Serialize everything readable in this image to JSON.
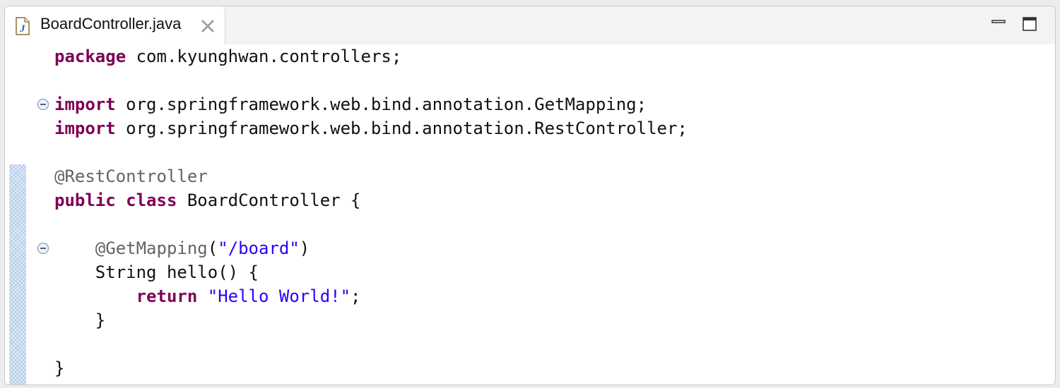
{
  "editor": {
    "tab": {
      "icon": "java-file-icon",
      "title": "BoardController.java",
      "close_icon": "close-x-icon"
    },
    "window_controls": {
      "minimize_icon": "minimize-icon",
      "maximize_icon": "maximize-icon"
    },
    "colors": {
      "keyword": "#7f0055",
      "annotation": "#646464",
      "string": "#2a00ff",
      "text": "#111111",
      "change_ruler": "#dde8f6"
    },
    "code": {
      "line1": {
        "kw": "package",
        "rest": " com.kyunghwan.controllers;"
      },
      "line3": {
        "kw": "import",
        "rest": " org.springframework.web.bind.annotation.GetMapping;"
      },
      "line4": {
        "kw": "import",
        "rest": " org.springframework.web.bind.annotation.RestController;"
      },
      "line6": {
        "ann": "@RestController"
      },
      "line7": {
        "kw1": "public",
        "sp": " ",
        "kw2": "class",
        "rest": " BoardController {"
      },
      "line9": {
        "indent": "    ",
        "ann": "@GetMapping",
        "open": "(",
        "str": "\"/board\"",
        "close": ")"
      },
      "line10": {
        "text": "    String hello() {"
      },
      "line11": {
        "indent": "        ",
        "kw": "return",
        "sp": " ",
        "str": "\"Hello World!\"",
        "end": ";"
      },
      "line12": {
        "text": "    }"
      },
      "line14": {
        "text": "}"
      }
    }
  }
}
